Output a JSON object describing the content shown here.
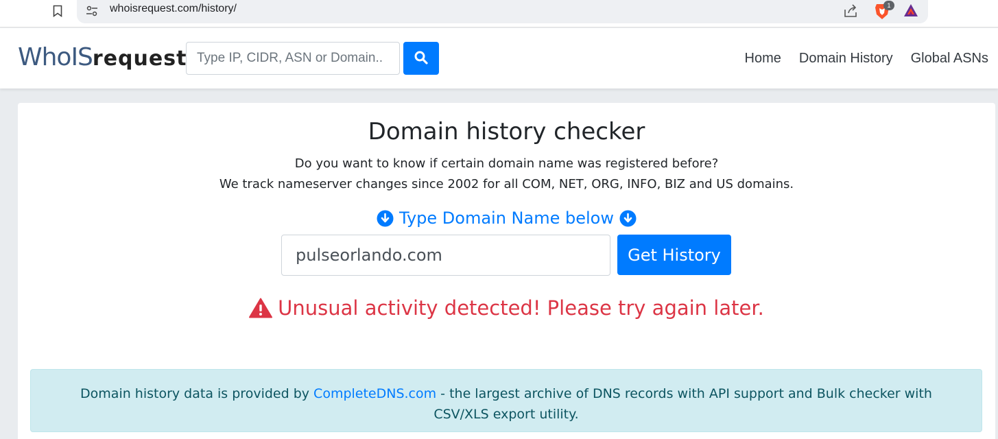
{
  "browser": {
    "url": "whoisrequest.com/history/",
    "extension_badge": "1"
  },
  "navbar": {
    "logo_part1": "WhoIS",
    "logo_part2": "request",
    "search_placeholder": "Type IP, CIDR, ASN or Domain..",
    "links": [
      "Home",
      "Domain History",
      "Global ASNs"
    ]
  },
  "main": {
    "title": "Domain history checker",
    "description_line1": "Do you want to know if certain domain name was registered before?",
    "description_line2": "We track nameserver changes since 2002 for all COM, NET, ORG, INFO, BIZ and US domains.",
    "type_label": "Type Domain Name below",
    "domain_input_value": "pulseorlando.com",
    "submit_label": "Get History",
    "alert_text": "Unusual activity detected! Please try again later."
  },
  "info": {
    "text_before": "Domain history data is provided by ",
    "link_text": "CompleteDNS.com",
    "text_after": " - the largest archive of DNS records with API support and Bulk checker with CSV/XLS export utility."
  },
  "colors": {
    "primary": "#007bff",
    "danger": "#dc3545",
    "info_bg": "#d1ecf1",
    "info_text": "#0c5460"
  }
}
